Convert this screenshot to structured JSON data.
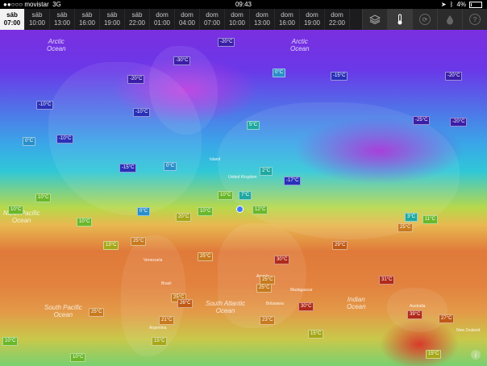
{
  "status_bar": {
    "carrier": "●●○○○ movistar",
    "network": "3G",
    "time": "09:43",
    "battery": "4%"
  },
  "timeline": [
    {
      "day": "sáb",
      "time": "07:00",
      "active": true
    },
    {
      "day": "sáb",
      "time": "10:00"
    },
    {
      "day": "sáb",
      "time": "13:00"
    },
    {
      "day": "sáb",
      "time": "16:00"
    },
    {
      "day": "sáb",
      "time": "19:00"
    },
    {
      "day": "sáb",
      "time": "22:00"
    },
    {
      "day": "dom",
      "time": "01:00"
    },
    {
      "day": "dom",
      "time": "04:00"
    },
    {
      "day": "dom",
      "time": "07:00"
    },
    {
      "day": "dom",
      "time": "10:00"
    },
    {
      "day": "dom",
      "time": "13:00"
    },
    {
      "day": "dom",
      "time": "16:00"
    },
    {
      "day": "dom",
      "time": "19:00"
    },
    {
      "day": "dom",
      "time": "22:00"
    }
  ],
  "toolbar": {
    "layers_icon": "layers-icon",
    "temperature_icon": "thermometer-icon",
    "wind_icon": "wind-icon",
    "precip_icon": "drop-icon",
    "help_label": "?"
  },
  "oceans": {
    "arctic_left": "Arctic\nOcean",
    "arctic_right": "Arctic\nOcean",
    "north_pacific": "North Pacific\nOcean",
    "south_pacific": "South Pacific\nOcean",
    "south_atlantic": "South Atlantic\nOcean",
    "indian": "Indian\nOcean"
  },
  "places": [
    "Island",
    "United Kingdom",
    "Brasil",
    "Argentina",
    "Australia",
    "New Zealand",
    "Madagascar",
    "Botswana",
    "Angola",
    "Venezuela"
  ],
  "temperatures": [
    "-20°C",
    "-30°C",
    "0°C",
    "-20°C",
    "-10°C",
    "-10°C",
    "-25°C",
    "-20°C",
    "-15°C",
    "-20°C",
    "0°C",
    "-10°C",
    "5°C",
    "-15°C",
    "0°C",
    "2°C",
    "-17°C",
    "0°C",
    "10°C",
    "10°C",
    "7°C",
    "10°C",
    "12°C",
    "20°C",
    "10°C",
    "3°C",
    "11°C",
    "10°C",
    "25°C",
    "13°C",
    "25°C",
    "25°C",
    "25°C",
    "29°C",
    "30°C",
    "25°C",
    "31°C",
    "25°C",
    "25°C",
    "26°C",
    "21°C",
    "30°C",
    "23°C",
    "39°C",
    "27°C",
    "15°C",
    "15°C",
    "10°C",
    "15°C",
    "10°C"
  ],
  "colors": {
    "cold": "#4a2ad0",
    "freezing": "#2fc7d8",
    "mild": "#c9c84a",
    "warm": "#e07a3a",
    "hot": "#d83a2a"
  },
  "info_label": "i"
}
